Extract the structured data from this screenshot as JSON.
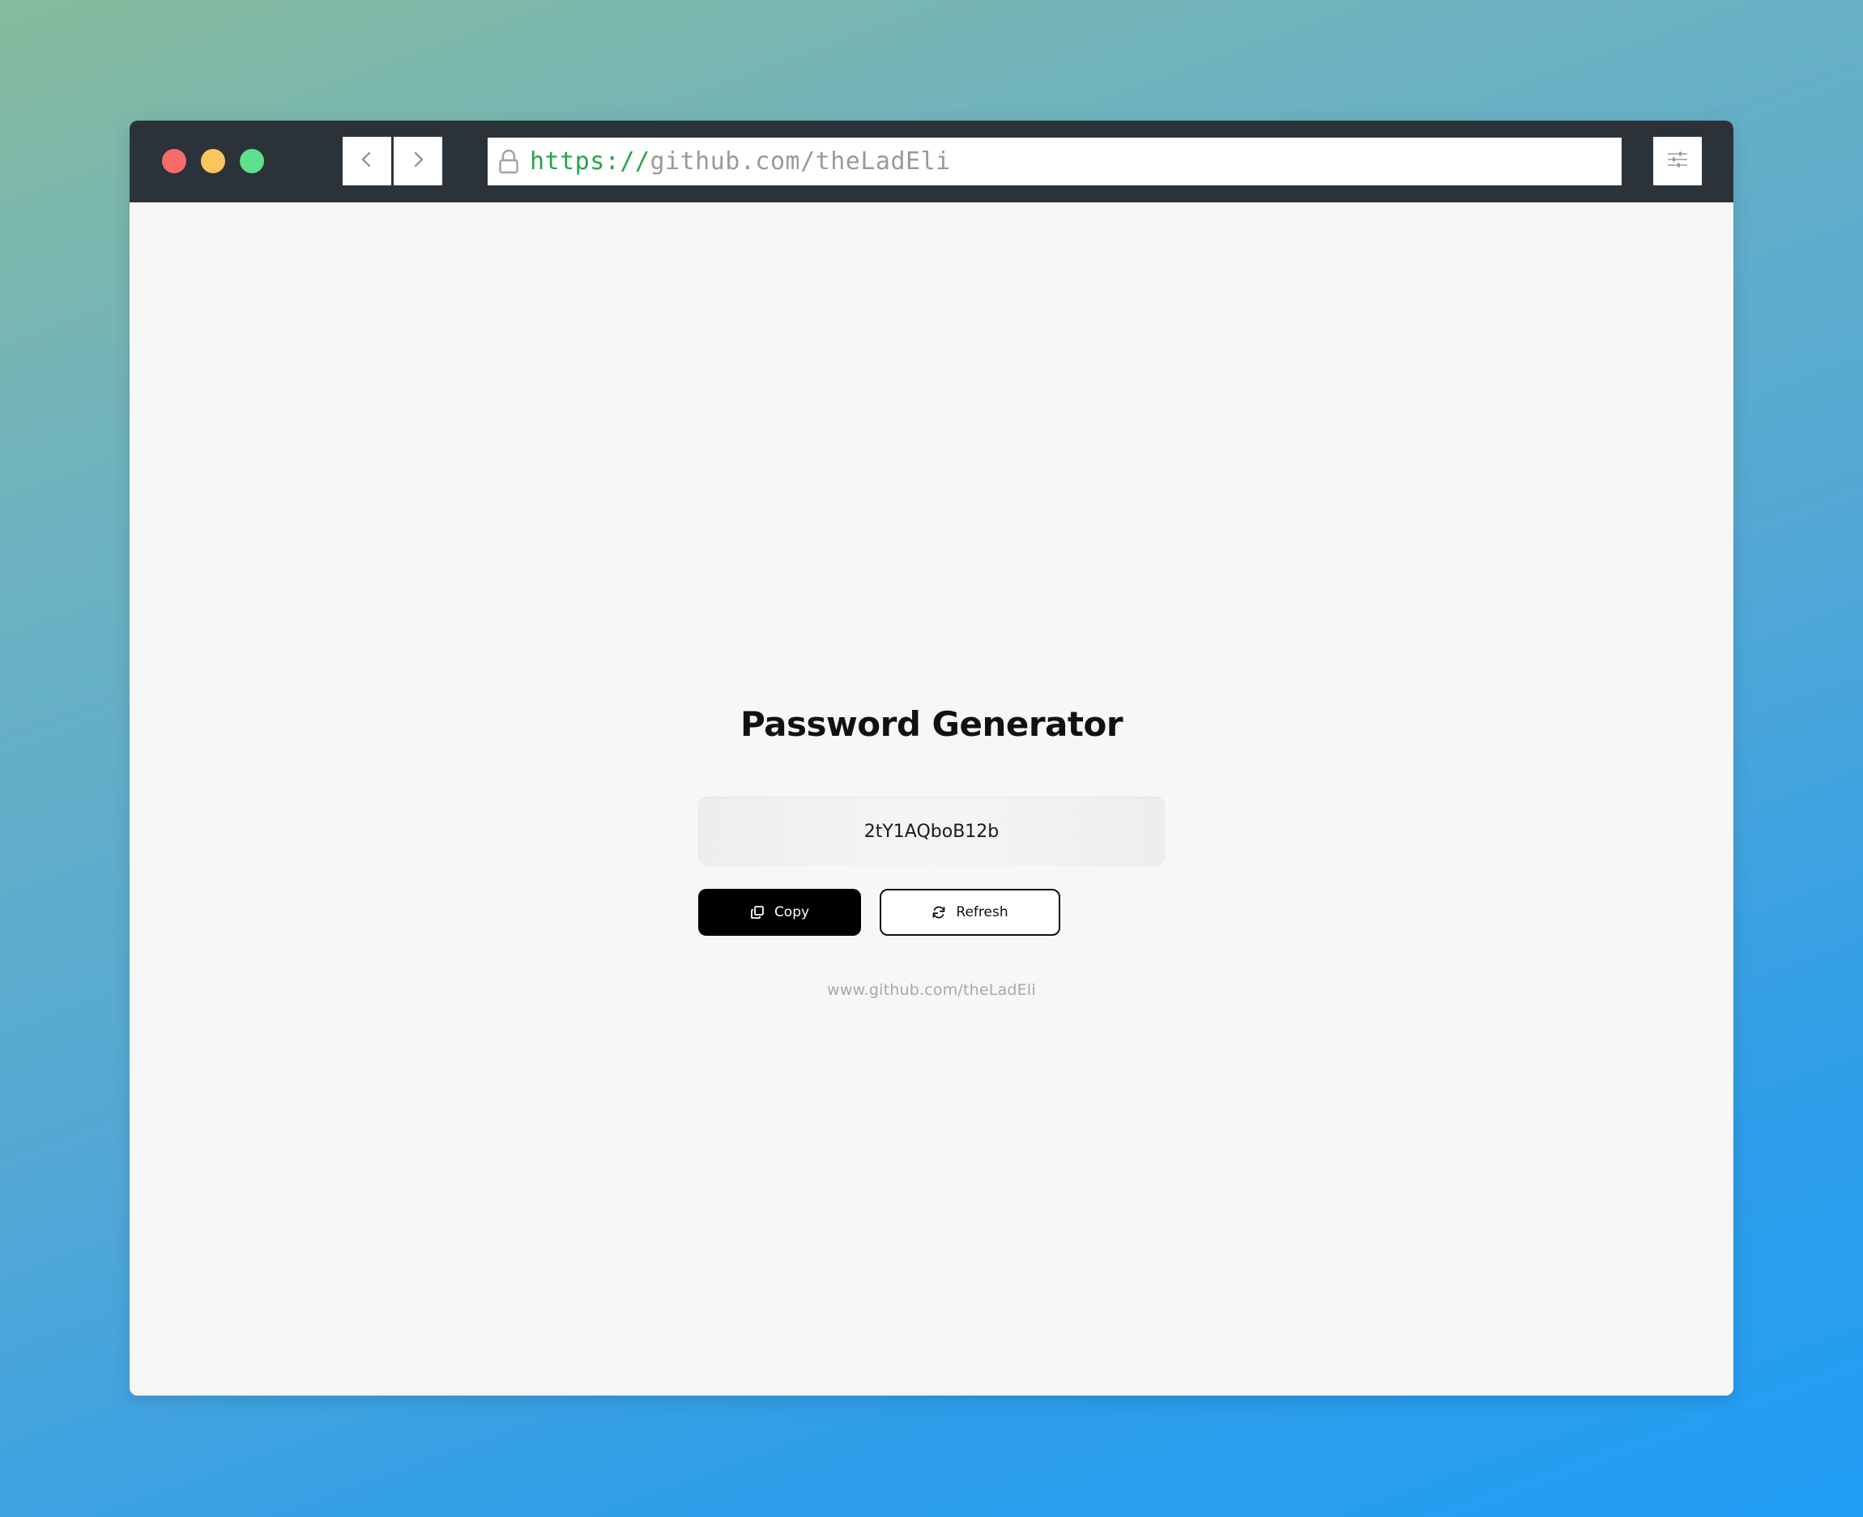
{
  "browser": {
    "url_scheme": "https://",
    "url_rest": "github.com/theLadEli",
    "traffic_colors": {
      "close": "#f76b6b",
      "minimize": "#f9c55c",
      "maximize": "#5fe08d"
    },
    "icons": {
      "back": "chevron-left-icon",
      "forward": "chevron-right-icon",
      "lock": "lock-icon",
      "menu": "sliders-icon"
    }
  },
  "app": {
    "title": "Password Generator",
    "password": "2tY1AQboB12b",
    "copy_label": "Copy",
    "refresh_label": "Refresh",
    "footer_link": "www.github.com/theLadEli",
    "icons": {
      "copy": "copy-icon",
      "refresh": "refresh-icon"
    },
    "colors": {
      "primary_button": "#000000",
      "secondary_button_border": "#111111"
    }
  }
}
